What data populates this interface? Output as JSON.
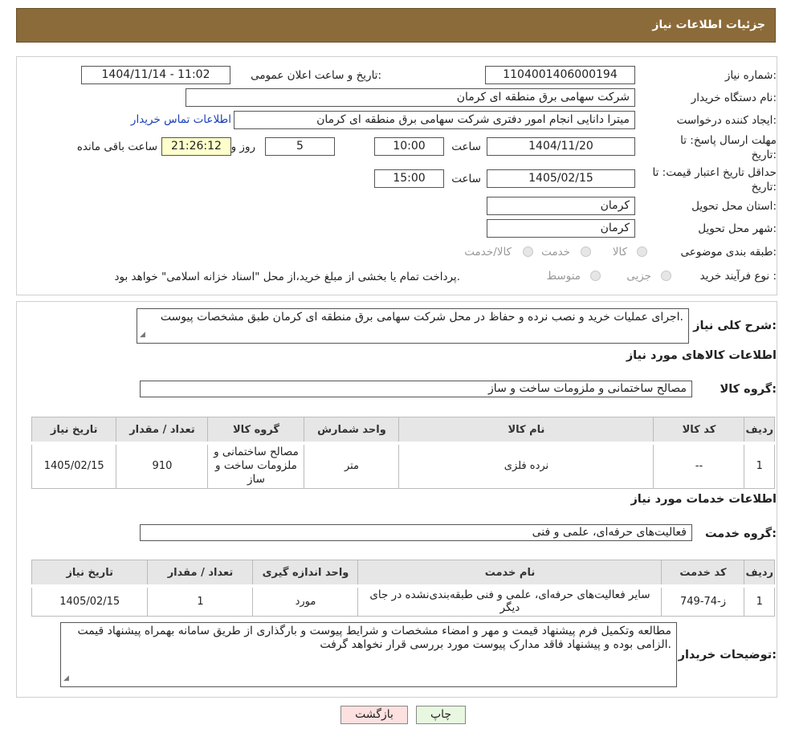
{
  "header": {
    "title": "جزئیات اطلاعات نیاز"
  },
  "form": {
    "need_number_label": "شماره نیاز:",
    "need_number": "1104001406000194",
    "announce_label": "تاریخ و ساعت اعلان عمومی:",
    "announce_value": "1404/11/14 - 11:02",
    "buyer_label": "نام دستگاه خریدار:",
    "buyer_value": "شرکت سهامی برق منطقه ای کرمان",
    "creator_label": "ایجاد کننده درخواست:",
    "creator_value": "میترا دانایی انجام امور دفتری شرکت سهامی برق منطقه ای کرمان",
    "contact_link": "اطلاعات تماس خریدار",
    "deadline_label": "مهلت ارسال پاسخ: تا تاریخ:",
    "deadline_date": "1404/11/20",
    "time_label": "ساعت",
    "deadline_time": "10:00",
    "days_value": "5",
    "days_label": "روز و",
    "remaining_value": "21:26:12",
    "remaining_label": "ساعت باقی مانده",
    "validity_label": "حداقل تاریخ اعتبار قیمت: تا تاریخ:",
    "validity_date": "1405/02/15",
    "validity_time": "15:00",
    "province_label": "استان محل تحویل:",
    "province_value": "کرمان",
    "city_label": "شهر محل تحویل:",
    "city_value": "کرمان",
    "category_label": "طبقه بندی موضوعی:",
    "category_options": [
      "کالا",
      "خدمت",
      "کالا/خدمت"
    ],
    "process_label": "نوع فرآیند خرید :",
    "process_options": [
      "جزیی",
      "متوسط"
    ],
    "process_note": "پرداخت تمام یا بخشی از مبلغ خرید،از محل \"اسناد خزانه اسلامی\" خواهد بود."
  },
  "description": {
    "label": "شرح کلی نیاز:",
    "text": "اجرای عملیات خرید و نصب نرده و حفاظ در محل شرکت سهامی برق منطقه ای کرمان طبق مشخصات پیوست."
  },
  "goods": {
    "section_title": "اطلاعات کالاهای مورد نیاز",
    "group_label": "گروه کالا:",
    "group_value": "مصالح ساختمانی و ملزومات ساخت و ساز",
    "headers": [
      "ردیف",
      "کد کالا",
      "نام کالا",
      "واحد شمارش",
      "گروه کالا",
      "تعداد / مقدار",
      "تاریخ نیاز"
    ],
    "rows": [
      [
        "1",
        "--",
        "نرده فلزی",
        "متر",
        "مصالح ساختمانی و ملزومات ساخت و ساز",
        "910",
        "1405/02/15"
      ]
    ]
  },
  "services": {
    "section_title": "اطلاعات خدمات مورد نیاز",
    "group_label": "گروه خدمت:",
    "group_value": "فعالیت‌های حرفه‌ای، علمی و فنی",
    "headers": [
      "ردیف",
      "کد خدمت",
      "نام خدمت",
      "واحد اندازه گیری",
      "تعداد / مقدار",
      "تاریخ نیاز"
    ],
    "rows": [
      [
        "1",
        "ز-74-749",
        "سایر فعالیت‌های حرفه‌ای، علمی و فنی طبقه‌بندی‌نشده در جای دیگر",
        "مورد",
        "1",
        "1405/02/15"
      ]
    ]
  },
  "notes": {
    "label": "توضیحات خریدار:",
    "text": "مطالعه وتکمیل فرم پیشنهاد قیمت و مهر و امضاء مشخصات و شرایط پیوست و بارگذاری از طریق سامانه بهمراه پیشنهاد قیمت الزامی بوده و پیشنهاد فاقد مدارک پیوست مورد بررسی قرار نخواهد گرفت."
  },
  "buttons": {
    "print": "چاپ",
    "back": "بازگشت"
  },
  "colors": {
    "header": "#8b6b3a",
    "print_btn": "#e8f8e0",
    "back_btn": "#fde0e0",
    "link": "#1a3fb5"
  }
}
